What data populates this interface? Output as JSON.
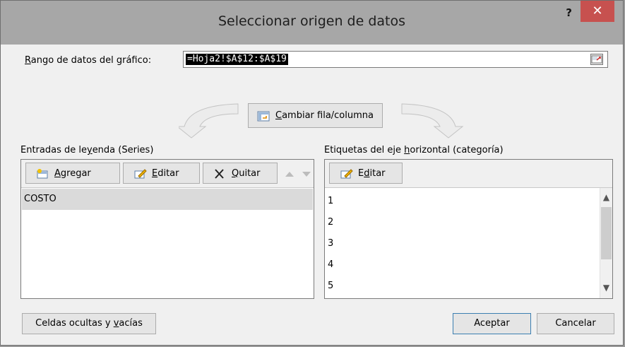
{
  "window": {
    "title": "Seleccionar origen de datos",
    "help_label": "?",
    "close_label": "✕"
  },
  "range": {
    "label_prefix": "R",
    "label_rest": "ango de datos del gráfico:",
    "value": "=Hoja2!$A$12:$A$19"
  },
  "switch_button": {
    "label_prefix": "C",
    "label_rest": "ambiar fila/columna"
  },
  "legend_panel": {
    "title_prefix": "Entradas de le",
    "title_underlined": "y",
    "title_rest": "enda (Series)",
    "buttons": {
      "add_prefix": "A",
      "add_rest": "gregar",
      "edit_prefix": "E",
      "edit_rest": "ditar",
      "remove_prefix": "Q",
      "remove_rest": "uitar"
    },
    "series": [
      "COSTO"
    ]
  },
  "axis_panel": {
    "title_prefix": "Etiquetas del eje ",
    "title_underlined": "h",
    "title_rest": "orizontal (categoría)",
    "edit_prefix": "E",
    "edit_underlined": "d",
    "edit_rest": "itar",
    "items": [
      "1",
      "2",
      "3",
      "4",
      "5"
    ]
  },
  "footer": {
    "hidden_cells_prefix": "Celdas ocultas y ",
    "hidden_cells_underlined": "v",
    "hidden_cells_rest": "acías",
    "accept_label": "Aceptar",
    "cancel_label": "Cancelar"
  },
  "colors": {
    "titlebar": "#a7a7a7",
    "close": "#c7514f",
    "selection": "#dadada"
  }
}
